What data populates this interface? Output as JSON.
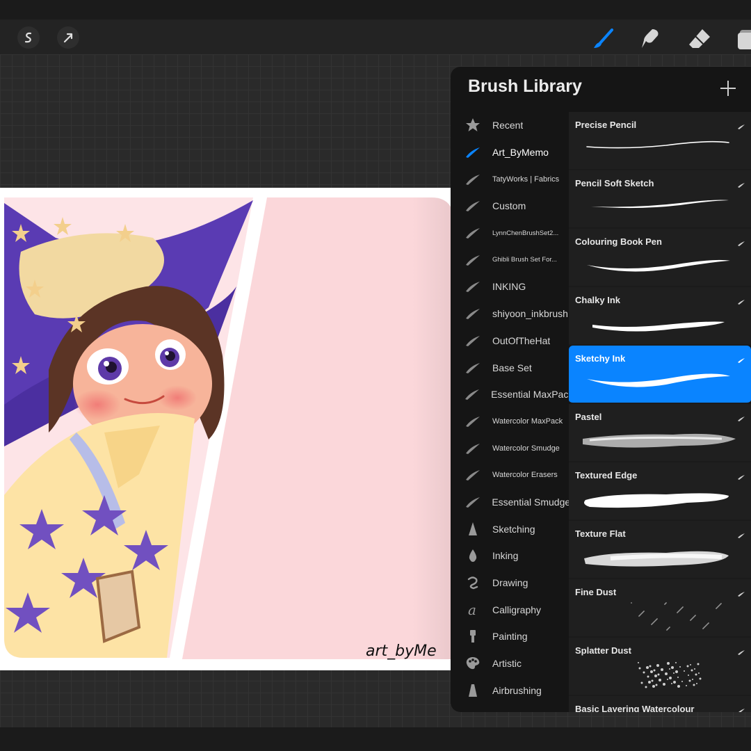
{
  "toolbar": {
    "left_buttons": [
      {
        "name": "selection",
        "icon": "s-curve-icon"
      },
      {
        "name": "transform",
        "icon": "arrow-cursor-icon"
      }
    ],
    "tools": [
      {
        "name": "brush",
        "icon": "brush-icon",
        "active": true
      },
      {
        "name": "smudge",
        "icon": "smudge-icon",
        "active": false
      },
      {
        "name": "eraser",
        "icon": "eraser-icon",
        "active": false
      },
      {
        "name": "layers",
        "icon": "layers-icon",
        "active": false
      }
    ],
    "accent_color": "#0a84ff"
  },
  "canvas": {
    "signature": "art_byMe"
  },
  "brush_library": {
    "title": "Brush Library",
    "sets": [
      {
        "label": "Recent",
        "icon": "star-icon"
      },
      {
        "label": "Art_ByMemo",
        "icon": "stroke-icon",
        "active": true
      },
      {
        "label": "TatyWorks | Fabrics",
        "icon": "stroke-icon",
        "size": "small"
      },
      {
        "label": "Custom",
        "icon": "stroke-icon"
      },
      {
        "label": "LynnChenBrushSet2...",
        "icon": "stroke-icon",
        "size": "tiny"
      },
      {
        "label": "Ghibli Brush Set For...",
        "icon": "stroke-icon",
        "size": "tiny"
      },
      {
        "label": "INKING",
        "icon": "stroke-icon"
      },
      {
        "label": "shiyoon_inkbrush",
        "icon": "stroke-icon"
      },
      {
        "label": "OutOfTheHat",
        "icon": "stroke-icon"
      },
      {
        "label": "Base Set",
        "icon": "stroke-icon"
      },
      {
        "label": "Essential MaxPack",
        "icon": "stroke-icon"
      },
      {
        "label": "Watercolor MaxPack",
        "icon": "stroke-icon",
        "size": "small"
      },
      {
        "label": "Watercolor Smudge",
        "icon": "stroke-icon",
        "size": "small"
      },
      {
        "label": "Watercolor Erasers",
        "icon": "stroke-icon",
        "size": "small"
      },
      {
        "label": "Essential Smudge",
        "icon": "stroke-icon"
      },
      {
        "label": "Sketching",
        "icon": "pencil-tip-icon"
      },
      {
        "label": "Inking",
        "icon": "ink-drop-icon"
      },
      {
        "label": "Drawing",
        "icon": "squiggle-icon"
      },
      {
        "label": "Calligraphy",
        "icon": "calligraphy-a-icon"
      },
      {
        "label": "Painting",
        "icon": "paint-brush-icon"
      },
      {
        "label": "Artistic",
        "icon": "palette-icon"
      },
      {
        "label": "Airbrushing",
        "icon": "airbrush-icon"
      }
    ],
    "brushes": [
      {
        "name": "Precise Pencil",
        "stroke": "thin"
      },
      {
        "name": "Pencil Soft Sketch",
        "stroke": "thin-taper"
      },
      {
        "name": "Colouring Book Pen",
        "stroke": "medium"
      },
      {
        "name": "Chalky Ink",
        "stroke": "chalky"
      },
      {
        "name": "Sketchy Ink",
        "stroke": "swoosh",
        "selected": true
      },
      {
        "name": "Pastel",
        "stroke": "pastel"
      },
      {
        "name": "Textured Edge",
        "stroke": "thick"
      },
      {
        "name": "Texture Flat",
        "stroke": "flat"
      },
      {
        "name": "Fine Dust",
        "stroke": "dust"
      },
      {
        "name": "Splatter Dust",
        "stroke": "splatter"
      },
      {
        "name": "Basic Layering Watercolour",
        "stroke": "watercolour"
      }
    ]
  }
}
